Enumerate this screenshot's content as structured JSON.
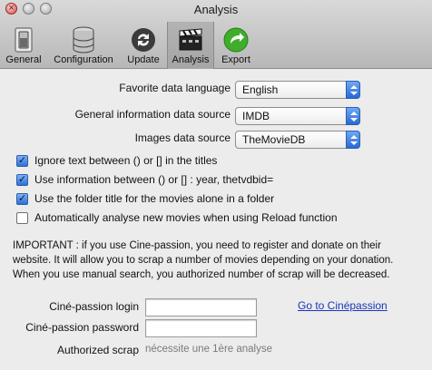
{
  "window": {
    "title": "Analysis"
  },
  "toolbar": {
    "items": [
      {
        "label": "General",
        "icon": "switch-icon"
      },
      {
        "label": "Configuration",
        "icon": "database-icon"
      },
      {
        "label": "Update",
        "icon": "refresh-icon"
      },
      {
        "label": "Analysis",
        "icon": "clapperboard-icon",
        "selected": true
      },
      {
        "label": "Export",
        "icon": "green-arrow-icon"
      }
    ]
  },
  "form": {
    "language": {
      "label": "Favorite data language",
      "value": "English"
    },
    "info_source": {
      "label": "General information data source",
      "value": "IMDB"
    },
    "images_source": {
      "label": "Images data source",
      "value": "TheMovieDB"
    }
  },
  "checkboxes": [
    {
      "label": "Ignore text between () or [] in the titles",
      "checked": true
    },
    {
      "label": "Use information between () or [] : year, thetvdbid=",
      "checked": true
    },
    {
      "label": "Use the folder title for the movies alone in a folder",
      "checked": true
    },
    {
      "label": "Automatically analyse new movies when using Reload function",
      "checked": false
    }
  ],
  "important": {
    "text": "IMPORTANT : if you use Cine-passion, you need to register and donate on their website. It will allow you to scrap a number of movies depending on your donation. When you use manual search, you authorized number of scrap will be decreased."
  },
  "cinepassion": {
    "login_label": "Ciné-passion login",
    "login_value": "",
    "password_label": "Ciné-passion password",
    "password_value": "",
    "link_label": "Go to Cinépassion",
    "scrap_label": "Authorized scrap",
    "scrap_value": "nécessite une 1ère analyse"
  },
  "colors": {
    "link": "#1a36b8",
    "accent": "#2d6fd8"
  }
}
